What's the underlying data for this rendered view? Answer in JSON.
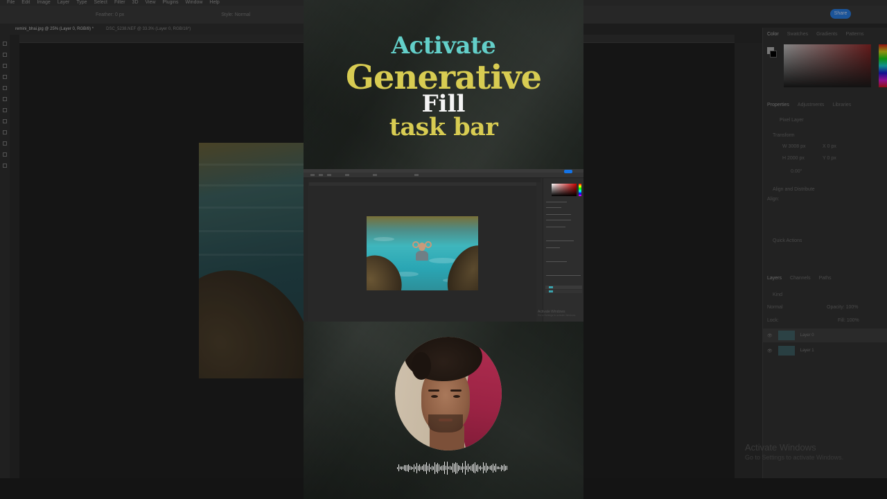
{
  "background_app": {
    "menu": [
      "File",
      "Edit",
      "Image",
      "Layer",
      "Type",
      "Select",
      "Filter",
      "3D",
      "View",
      "Plugins",
      "Window",
      "Help"
    ],
    "options": {
      "feather": "Feather: 0 px",
      "style": "Style: Normal"
    },
    "share_label": "Share",
    "tabs": [
      "remini_bhai.jpg @ 25% (Layer 0, RGB/8) *",
      "DSC_5238.NEF @ 33.3% (Layer 0, RGB/16*)"
    ],
    "panel_tabs": [
      "Color",
      "Swatches",
      "Gradients",
      "Patterns"
    ],
    "properties_tabs": [
      "Properties",
      "Adjustments",
      "Libraries"
    ],
    "properties": {
      "pixel_layer": "Pixel Layer",
      "transform": "Transform",
      "w": "W 3008 px",
      "h": "H 2000 px",
      "x": "X 0 px",
      "y": "Y 0 px",
      "angle": "0.00°",
      "align": "Align and Distribute",
      "align_sub": "Align:",
      "quick_actions": "Quick Actions"
    },
    "layers_tabs": [
      "Layers",
      "Channels",
      "Paths"
    ],
    "layers": {
      "kind": "Kind",
      "blend": "Normal",
      "opacity": "Opacity: 100%",
      "lock": "Lock:",
      "fill": "Fill: 100%",
      "items": [
        "Layer 0",
        "Layer 1"
      ]
    },
    "activate_windows": {
      "title": "Activate Windows",
      "subtitle": "Go to Settings to activate Windows."
    }
  },
  "reel": {
    "headline": {
      "line1": "Activate",
      "line2": "Generative",
      "line3": "Fill",
      "line4": "task bar"
    },
    "mini_screen": {
      "activate_windows": "Activate Windows",
      "activate_sub": "Go to Settings to activate Windows."
    },
    "colors": {
      "teal": "#63cfc9",
      "yellow": "#d8cc52",
      "white": "#f4f4f4"
    },
    "waveform": {
      "icon": "audio-waveform-icon"
    }
  }
}
